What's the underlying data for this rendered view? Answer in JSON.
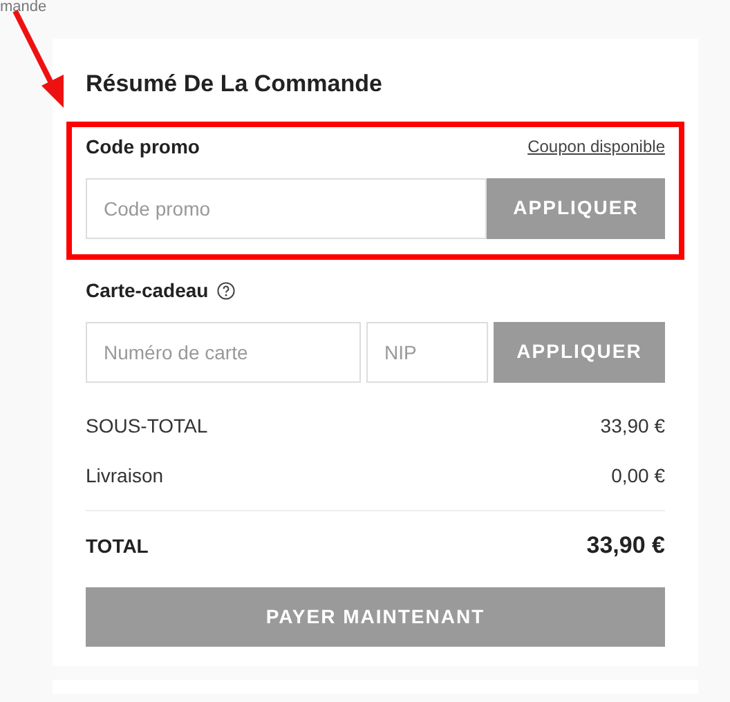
{
  "page_fragment": "mande",
  "summary": {
    "title": "Résumé De La Commande",
    "promo": {
      "label": "Code promo",
      "link": "Coupon disponible",
      "placeholder": "Code promo",
      "button": "APPLIQUER",
      "button_disabled": true,
      "highlighted": true
    },
    "gift_card": {
      "label": "Carte-cadeau",
      "card_placeholder": "Numéro de carte",
      "pin_placeholder": "NIP",
      "button": "APPLIQUER",
      "button_disabled": true
    },
    "lines": [
      {
        "kind": "line",
        "label": "SOUS-TOTAL",
        "amount": "33,90 €"
      },
      {
        "kind": "line",
        "label": "Livraison",
        "amount": "0,00 €"
      },
      {
        "kind": "total",
        "label": "TOTAL",
        "amount": "33,90 €"
      }
    ],
    "pay_button": {
      "label": "PAYER MAINTENANT",
      "disabled": true
    }
  }
}
